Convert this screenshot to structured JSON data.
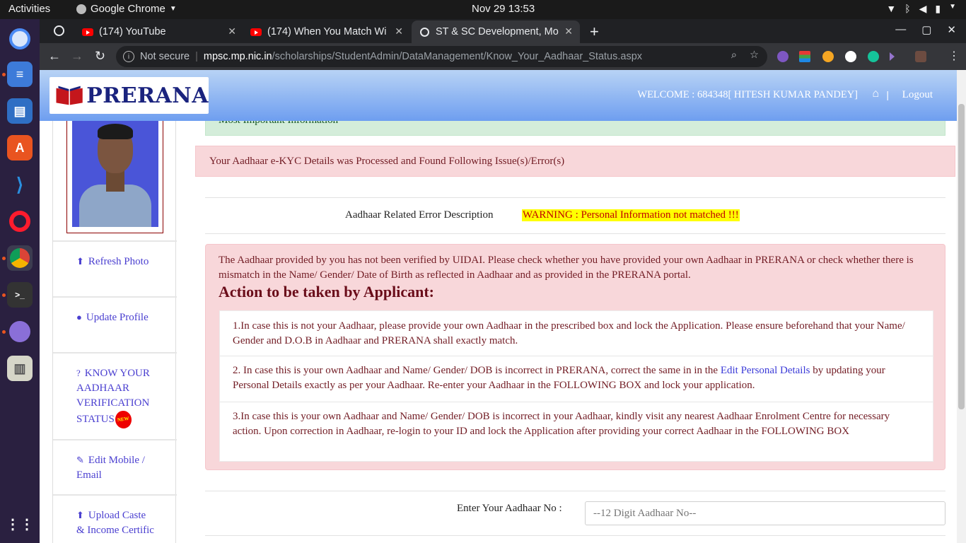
{
  "system": {
    "activities": "Activities",
    "app_name": "Google Chrome",
    "clock": "Nov 29  13:53"
  },
  "browser": {
    "tabs": [
      {
        "label": "(174) YouTube"
      },
      {
        "label": "(174) When You Match Wi"
      },
      {
        "label": "ST & SC Development, Mo"
      }
    ],
    "omnibox": {
      "security": "Not secure",
      "host": "mpsc.mp.nic.in",
      "path": "/scholarships/StudentAdmin/DataManagement/Know_Your_Aadhaar_Status.aspx"
    }
  },
  "header": {
    "logo_text": "PRERANA",
    "welcome": "WELCOME : 684348[ HITESH KUMAR PANDEY]",
    "separator": "|",
    "logout": "Logout"
  },
  "sidebar": {
    "items": [
      {
        "label": "Refresh Photo",
        "icon": "upload-icon"
      },
      {
        "label": "Update Profile",
        "icon": "user-icon"
      },
      {
        "label": "KNOW YOUR AADHAAR VERIFICATION STATUS",
        "icon": "question-icon",
        "badge": "NEW"
      },
      {
        "label": "Edit Mobile / Email",
        "icon": "edit-icon"
      },
      {
        "label": "Upload Caste & Income Certific",
        "icon": "upload-icon"
      }
    ]
  },
  "main": {
    "top_info": "Most Important Information",
    "alert": "Your Aadhaar e-KYC Details was Processed and Found Following Issue(s)/Error(s)",
    "error_label": "Aadhaar Related Error Description",
    "error_value": "WARNING : Personal Information not matched !!!",
    "description": "The Aadhaar provided by you has not been verified by UIDAI. Please check whether you have provided your own Aadhaar in PRERANA or check whether there is mismatch in the Name/ Gender/ Date of Birth as reflected in Aadhaar and as provided in the PRERANA portal.",
    "action_title": "Action to be taken by Applicant:",
    "actions": {
      "a1": "1.In case this is not your Aadhaar, please provide your own Aadhaar in the prescribed box and lock the Application. Please ensure beforehand that your Name/ Gender and D.O.B in Aadhaar and PRERANA shall exactly match.",
      "a2_pre": "2. In case this is your own Aadhaar and Name/ Gender/ DOB is incorrect in PRERANA, correct the same in in the ",
      "a2_link": "Edit Personal Details",
      "a2_post": " by updating your Personal Details exactly as per your Aadhaar. Re-enter your Aadhaar in the FOLLOWING BOX and lock your application.",
      "a3": "3.In case this is your own Aadhaar and Name/ Gender/ DOB is incorrect in your Aadhaar, kindly visit any nearest Aadhaar Enrolment Centre for necessary action. Upon correction in Aadhaar, re-login to your ID and lock the Application after providing your correct Aadhaar in the FOLLOWING BOX"
    },
    "aadhaar_label": "Enter Your Aadhaar No :",
    "aadhaar_placeholder": "--12 Digit Aadhaar No--"
  }
}
